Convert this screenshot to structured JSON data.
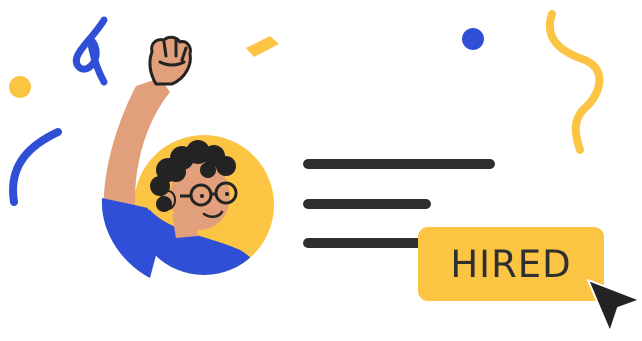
{
  "badge": {
    "label": "HIRED"
  },
  "colors": {
    "yellow": "#fcc443",
    "blue": "#2e4fd6",
    "skin": "#e29f7b",
    "hair": "#232323",
    "text_lines": "#2f2f2f",
    "cursor": "#232323"
  },
  "icons": {
    "cursor": "cursor-arrow-icon",
    "avatar": "person-cheering-icon"
  }
}
